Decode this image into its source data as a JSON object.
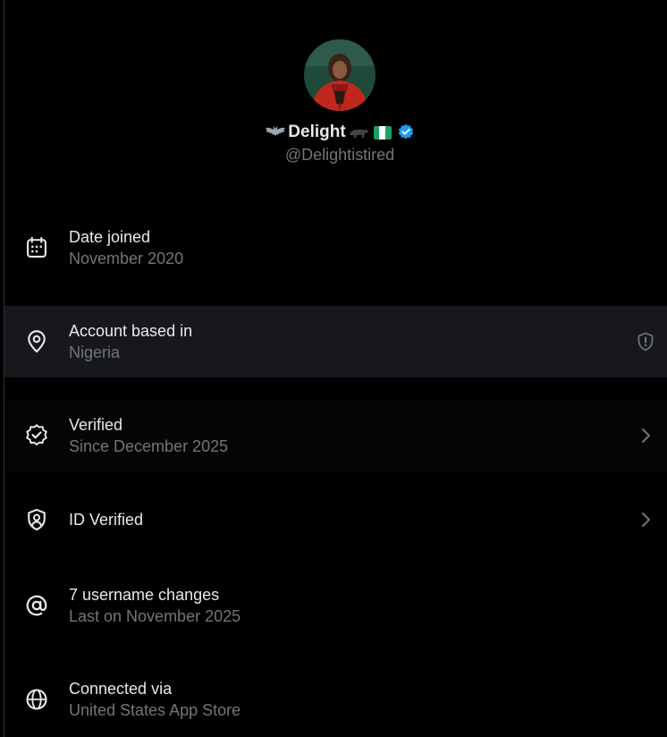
{
  "profile": {
    "display_name": "Delight",
    "handle": "@Delightistired",
    "verified_badge_color": "#1d9bf0"
  },
  "rows": [
    {
      "icon": "calendar-icon",
      "title": "Date joined",
      "subtitle": "November 2020"
    },
    {
      "icon": "location-pin-icon",
      "title": "Account based in",
      "subtitle": "Nigeria",
      "trailing": "shield-alert-icon"
    },
    {
      "icon": "verified-check-icon",
      "title": "Verified",
      "subtitle": "Since December 2025",
      "trailing": "chevron-right-icon"
    },
    {
      "icon": "id-shield-icon",
      "title": "ID Verified",
      "subtitle": "",
      "trailing": "chevron-right-icon"
    },
    {
      "icon": "at-sign-icon",
      "title": "7 username changes",
      "subtitle": "Last on November 2025"
    },
    {
      "icon": "globe-icon",
      "title": "Connected via",
      "subtitle": "United States App Store"
    }
  ],
  "colors": {
    "background": "#000000",
    "text_primary": "#e7e9ea",
    "text_secondary": "#71767b",
    "highlight_row": "#16181c"
  }
}
